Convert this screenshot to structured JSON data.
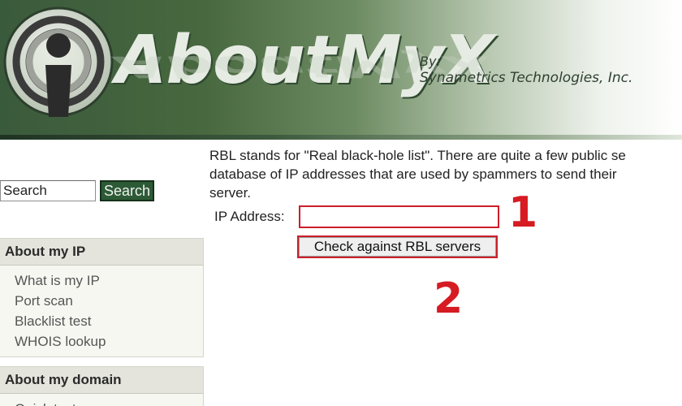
{
  "header": {
    "brand": "AboutMyX",
    "by_label": "By:",
    "company": "Synametrics Technologies, Inc.",
    "colors": {
      "banner_dark": "#3a5a3c",
      "banner_light": "#ffffff"
    }
  },
  "sidebar": {
    "search": {
      "value": "Search",
      "button_label": "Search"
    },
    "sections": [
      {
        "title": "About my IP",
        "items": [
          {
            "label": "What is my IP"
          },
          {
            "label": "Port scan"
          },
          {
            "label": "Blacklist test"
          },
          {
            "label": "WHOIS lookup"
          }
        ]
      },
      {
        "title": "About my domain",
        "items": [
          {
            "label": "Quick test"
          }
        ]
      }
    ]
  },
  "main": {
    "intro_lines": [
      "RBL stands for \"Real black-hole list\". There are quite a few public se",
      "database of IP addresses that are used by spammers to send their",
      "server."
    ],
    "ip_label": "IP Address:",
    "ip_value": "",
    "check_button_label": "Check against RBL servers"
  },
  "annotations": {
    "step_1": "1",
    "step_2": "2",
    "color": "#d61b22"
  }
}
